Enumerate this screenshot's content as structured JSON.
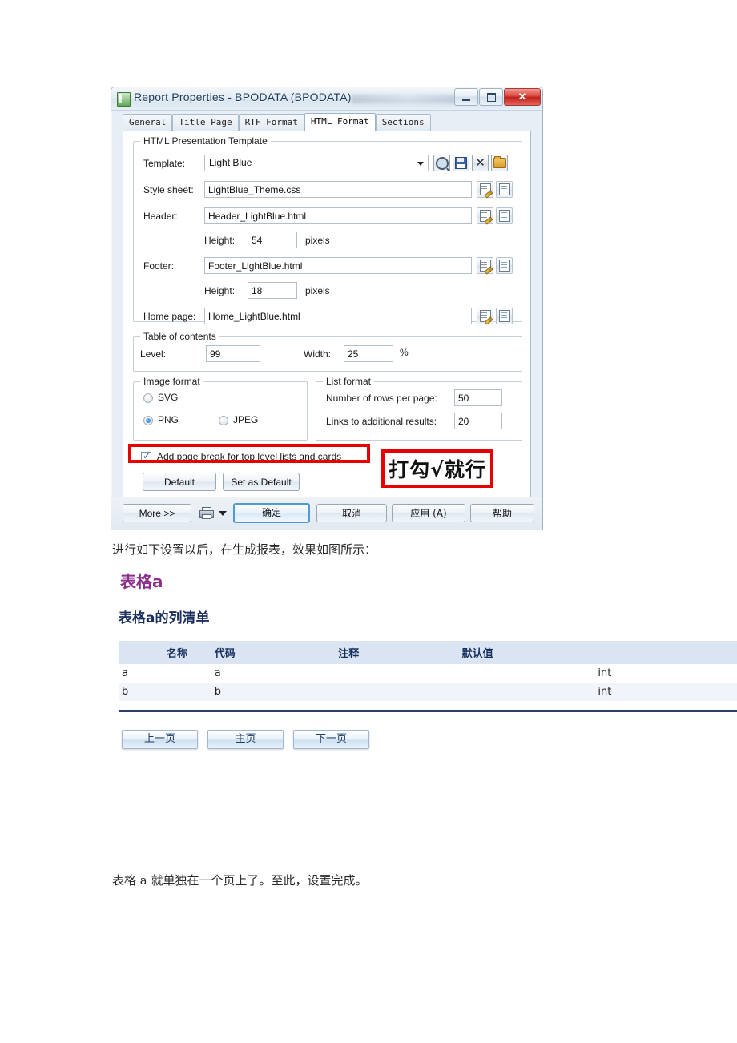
{
  "dialog": {
    "title": "Report Properties - BPODATA (BPODATA)",
    "window_buttons": {
      "minimize": "minimize-button",
      "maximize": "maximize-button",
      "close": "close-button"
    },
    "tabs": [
      {
        "label": "General",
        "active": false
      },
      {
        "label": "Title Page",
        "active": false
      },
      {
        "label": "RTF Format",
        "active": false
      },
      {
        "label": "HTML Format",
        "active": true
      },
      {
        "label": "Sections",
        "active": false
      }
    ],
    "presentation_group": {
      "legend": "HTML Presentation Template",
      "template_label": "Template:",
      "template_value": "Light Blue",
      "style_sheet_label": "Style sheet:",
      "style_sheet_value": "LightBlue_Theme.css",
      "header_label": "Header:",
      "header_value": "Header_LightBlue.html",
      "header_height_label": "Height:",
      "header_height_value": "54",
      "header_height_unit": "pixels",
      "footer_label": "Footer:",
      "footer_value": "Footer_LightBlue.html",
      "footer_height_label": "Height:",
      "footer_height_value": "18",
      "footer_height_unit": "pixels",
      "home_page_label": "Home page:",
      "home_page_value": "Home_LightBlue.html"
    },
    "toc_group": {
      "legend": "Table of contents",
      "level_label": "Level:",
      "level_value": "99",
      "width_label": "Width:",
      "width_value": "25",
      "width_unit": "%"
    },
    "image_format_group": {
      "legend": "Image format",
      "options": [
        {
          "label": "SVG",
          "selected": false
        },
        {
          "label": "PNG",
          "selected": true
        },
        {
          "label": "JPEG",
          "selected": false
        }
      ]
    },
    "list_format_group": {
      "legend": "List format",
      "rows_label": "Number of rows per page:",
      "rows_value": "50",
      "links_label": "Links to additional results:",
      "links_value": "20"
    },
    "page_break_checkbox": {
      "label": "Add page break for top level lists and cards",
      "checked": true
    },
    "default_button": "Default",
    "set_as_default_button": "Set as Default",
    "footer_buttons": {
      "more": "More >>",
      "ok": "确定",
      "cancel": "取消",
      "apply": "应用 (A)",
      "help": "帮助"
    }
  },
  "annotation": {
    "text": "打勾√就行",
    "border_color": "#e60000"
  },
  "document": {
    "intro_text": "进行如下设置以后，在生成报表，效果如图所示：",
    "heading_table": "表格a",
    "heading_columns": "表格a的列清单",
    "closing_text": "表格 a 就单独在一个页上了。至此，设置完成。",
    "table": {
      "columns": [
        "名称",
        "代码",
        "注释",
        "默认值",
        ""
      ],
      "rows": [
        [
          "a",
          "a",
          "",
          "",
          "int"
        ],
        [
          "b",
          "b",
          "",
          "",
          "int"
        ]
      ]
    },
    "nav_buttons": [
      "上一页",
      "主页",
      "下一页"
    ],
    "colors": {
      "heading_purple": "#8e2f8e",
      "heading_navy": "#1b2f5e",
      "table_header_bg": "#dbe4f3",
      "rule": "#2b3e6b"
    }
  }
}
